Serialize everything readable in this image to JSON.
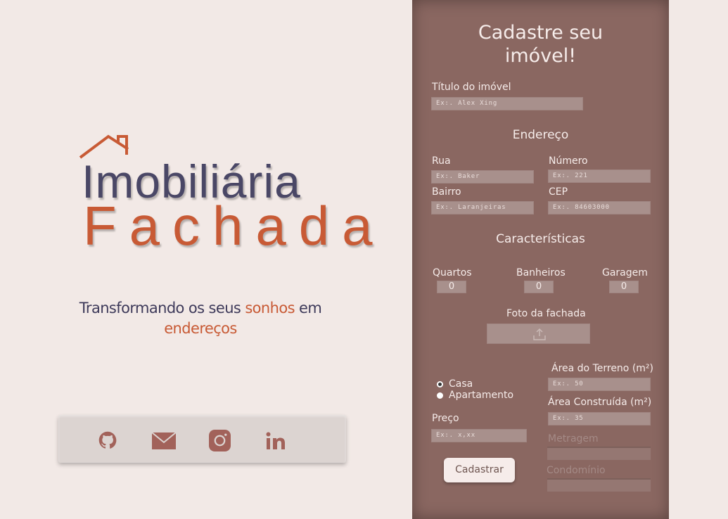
{
  "brand": {
    "name_line1": "Imobiliária",
    "name_line2": "Fachada",
    "tagline_part1": "Transformando os seus ",
    "tagline_highlight1": "sonhos",
    "tagline_part2": " em",
    "tagline_highlight2": "endereços"
  },
  "social": [
    {
      "icon": "github-icon"
    },
    {
      "icon": "mail-icon"
    },
    {
      "icon": "instagram-icon"
    },
    {
      "icon": "linkedin-icon"
    }
  ],
  "form": {
    "title_line1": "Cadastre seu",
    "title_line2": "imóvel!",
    "title_label": "Título do imóvel",
    "title_placeholder": "Ex:. Alex Xing",
    "address_section": "Endereço",
    "street_label": "Rua",
    "street_placeholder": "Ex:. Baker",
    "number_label": "Número",
    "number_placeholder": "Ex:. 221",
    "district_label": "Bairro",
    "district_placeholder": "Ex:. Laranjeiras",
    "cep_label": "CEP",
    "cep_placeholder": "Ex:. 84603000",
    "features_section": "Características",
    "bedrooms_label": "Quartos",
    "bedrooms_value": "0",
    "bathrooms_label": "Banheiros",
    "bathrooms_value": "0",
    "garage_label": "Garagem",
    "garage_value": "0",
    "photo_label": "Foto da fachada",
    "type_house": "Casa",
    "type_apartment": "Apartamento",
    "price_label": "Preço",
    "price_placeholder": "Ex:. x,xx",
    "land_area_label": "Área do Terreno (m²)",
    "land_area_placeholder": "Ex:. 50",
    "built_area_label": "Área Construída (m²)",
    "built_area_placeholder": "Ex:. 35",
    "footage_label": "Metragem",
    "condo_label": "Condomínio",
    "submit_label": "Cadastrar"
  },
  "colors": {
    "background": "#f2e9e6",
    "panel": "#8a6761",
    "brand_dark": "#4a4766",
    "brand_orange": "#c85a35"
  }
}
